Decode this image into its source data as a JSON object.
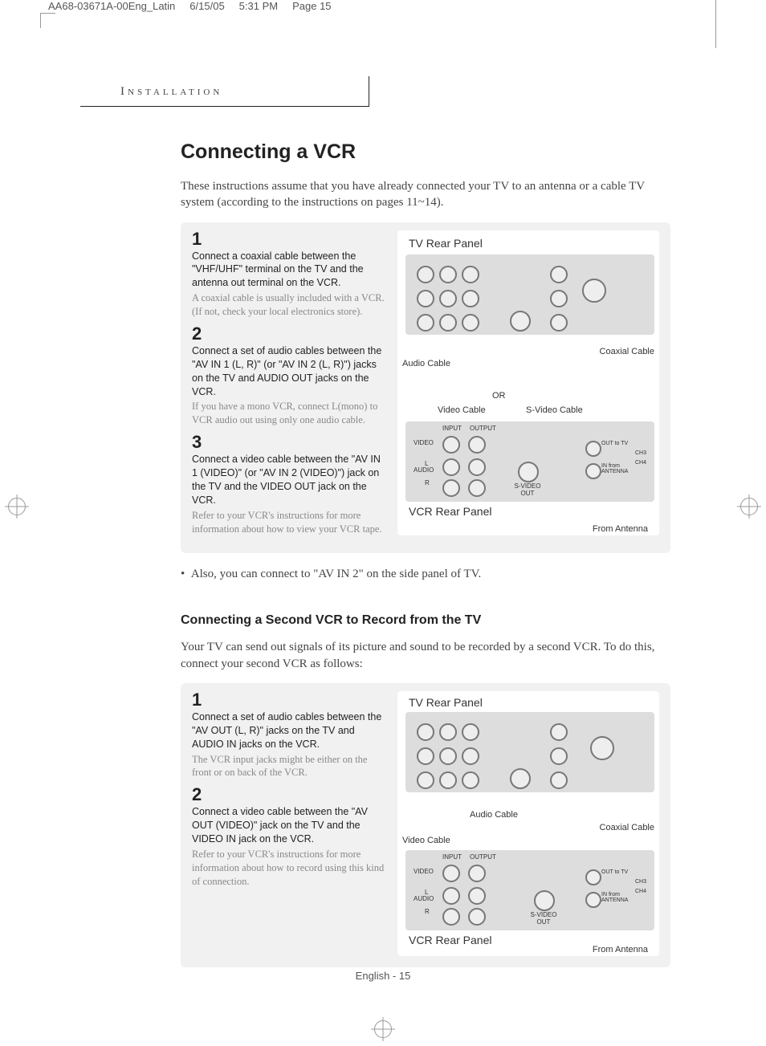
{
  "slug": {
    "file": "AA68-03671A-00Eng_Latin",
    "date": "6/15/05",
    "time": "5:31 PM",
    "page": "Page 15"
  },
  "header": "Installation",
  "title": "Connecting a VCR",
  "intro": "These instructions assume that you have already connected your TV to an antenna or a cable TV system (according to the instructions on pages 11~14).",
  "section1": {
    "steps": [
      {
        "num": "1",
        "bold": "Connect a coaxial cable between the \"VHF/UHF\" terminal on the TV and the antenna out terminal on the VCR.",
        "body": "A coaxial cable is usually included with a VCR. (If not, check your local electronics store)."
      },
      {
        "num": "2",
        "bold": "Connect a set of audio cables between the \"AV IN 1 (L, R)\" (or \"AV IN 2 (L, R)\") jacks on the TV and AUDIO OUT jacks on the VCR.",
        "body": "If you have a mono VCR, connect L(mono) to VCR audio out using only one audio cable."
      },
      {
        "num": "3",
        "bold": "Connect a video cable between the \"AV IN 1 (VIDEO)\" (or \"AV IN 2 (VIDEO)\") jack on the TV and the VIDEO OUT jack on the VCR.",
        "body": "Refer to your VCR's instructions for more information about how to view your VCR tape."
      }
    ],
    "diagram": {
      "tv_label": "TV Rear Panel",
      "vcr_label": "VCR Rear Panel",
      "audio_cable": "Audio Cable",
      "video_cable": "Video Cable",
      "svideo_cable": "S-Video Cable",
      "coax_cable": "Coaxial Cable",
      "or": "OR",
      "input": "INPUT",
      "output": "OUTPUT",
      "video": "VIDEO",
      "audio": "AUDIO",
      "l": "L",
      "r": "R",
      "svideo_out": "S-VIDEO OUT",
      "out_to_tv": "OUT to TV",
      "in_from_ant": "IN from ANTENNA",
      "ch3": "CH3",
      "ch4": "CH4",
      "from_antenna": "From Antenna"
    }
  },
  "note": "Also, you can connect to \"AV IN 2\" on the side panel of TV.",
  "subtitle": "Connecting a Second VCR to Record from the TV",
  "intro2": "Your TV can send out signals of its picture and sound to be recorded by a second VCR. To do this, connect your second VCR as follows:",
  "section2": {
    "steps": [
      {
        "num": "1",
        "bold": "Connect a set of audio cables between the \"AV OUT (L, R)\" jacks on the TV and AUDIO IN jacks on the VCR.",
        "body": "The VCR input jacks might be either on the front or on back of the VCR."
      },
      {
        "num": "2",
        "bold": "Connect a video cable between the \"AV OUT (VIDEO)\" jack on the TV and the VIDEO IN jack on the VCR.",
        "body": "Refer to your VCR's instructions for more information about how to record using this kind of connection."
      }
    ],
    "diagram": {
      "tv_label": "TV Rear Panel",
      "vcr_label": "VCR Rear Panel",
      "audio_cable": "Audio Cable",
      "video_cable": "Video Cable",
      "coax_cable": "Coaxial Cable",
      "input": "INPUT",
      "output": "OUTPUT",
      "video": "VIDEO",
      "audio": "AUDIO",
      "l": "L",
      "r": "R",
      "svideo_out": "S-VIDEO OUT",
      "out_to_tv": "OUT to TV",
      "in_from_ant": "IN from ANTENNA",
      "ch3": "CH3",
      "ch4": "CH4",
      "from_antenna": "From Antenna"
    }
  },
  "footer": "English - 15"
}
